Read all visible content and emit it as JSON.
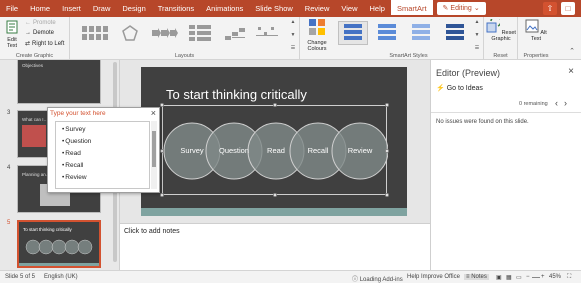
{
  "tabs": [
    "File",
    "Home",
    "Insert",
    "Draw",
    "Design",
    "Transitions",
    "Animations",
    "Slide Show",
    "Review",
    "View",
    "Help",
    "SmartArt"
  ],
  "active_tab": "SmartArt",
  "editing_label": "Editing",
  "colors": {
    "accent": "#b7472a",
    "slide_bg": "#404040",
    "circle_fill": "#7f8a88",
    "bar": "#7fa3a0"
  },
  "ribbon": {
    "create_graphic": {
      "label": "Create Graphic",
      "edit_text": "Edit Text",
      "promote": "Promote",
      "demote": "Demote",
      "right_to_left": "Right to Left"
    },
    "layouts_label": "Layouts",
    "change_colours": "Change Colours",
    "styles_label": "SmartArt Styles",
    "reset_graphic": "Reset Graphic",
    "reset_label": "Reset",
    "alt_text": "Alt Text",
    "properties_label": "Properties"
  },
  "thumbnails": [
    {
      "num": "",
      "title": "Objectives"
    },
    {
      "num": "3",
      "title": "What can I…"
    },
    {
      "num": "4",
      "title": "Planning an…"
    },
    {
      "num": "5",
      "title": "To start thinking critically",
      "selected": true
    }
  ],
  "text_pane": {
    "title": "Type your text here",
    "items": [
      "Survey",
      "Question",
      "Read",
      "Recall",
      "Review"
    ]
  },
  "slide": {
    "title": "To start thinking critically",
    "circles": [
      "Survey",
      "Question",
      "Read",
      "Recall",
      "Review"
    ]
  },
  "notes_placeholder": "Click to add notes",
  "editor_pane": {
    "title": "Editor (Preview)",
    "go_to_ideas": "Go to Ideas",
    "remaining": "0 remaining",
    "message": "No issues were found on this slide."
  },
  "status": {
    "slide": "Slide 5 of 5",
    "language": "English (UK)",
    "loading": "Loading Add-ins",
    "help": "Help Improve Office",
    "notes": "Notes",
    "zoom": "45%"
  }
}
